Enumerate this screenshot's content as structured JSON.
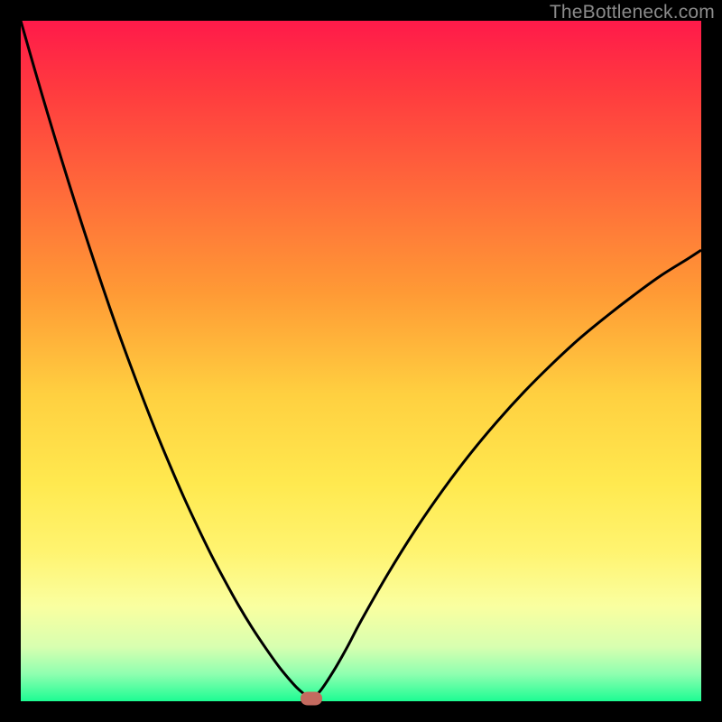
{
  "watermark": "TheBottleneck.com",
  "chart_data": {
    "type": "line",
    "title": "",
    "xlabel": "",
    "ylabel": "",
    "xlim": [
      0,
      100
    ],
    "ylim": [
      0,
      100
    ],
    "grid": false,
    "x": [
      0,
      2,
      4,
      6,
      8,
      10,
      12,
      14,
      16,
      18,
      20,
      22,
      24,
      26,
      28,
      30,
      32,
      34,
      36,
      38,
      40,
      41,
      42,
      42.7,
      44,
      46,
      48,
      50,
      54,
      58,
      62,
      66,
      70,
      74,
      78,
      82,
      86,
      90,
      94,
      98,
      100
    ],
    "values": [
      100,
      93,
      86.2,
      79.6,
      73.2,
      67,
      61,
      55.2,
      49.7,
      44.4,
      39.3,
      34.5,
      29.9,
      25.6,
      21.5,
      17.7,
      14.1,
      10.8,
      7.8,
      5.0,
      2.6,
      1.6,
      0.8,
      0.4,
      1.5,
      4.5,
      8.0,
      11.8,
      18.8,
      25.2,
      31.0,
      36.3,
      41.1,
      45.5,
      49.5,
      53.2,
      56.5,
      59.6,
      62.5,
      65.0,
      66.3
    ],
    "marker": {
      "x": 42.7,
      "y": 0.4
    },
    "gradient_stops": [
      {
        "pos": 0,
        "color": "#ff1a4a"
      },
      {
        "pos": 25,
        "color": "#ff6a3a"
      },
      {
        "pos": 55,
        "color": "#ffd040"
      },
      {
        "pos": 78,
        "color": "#fff470"
      },
      {
        "pos": 92,
        "color": "#d8ffb0"
      },
      {
        "pos": 100,
        "color": "#1dfc93"
      }
    ]
  }
}
